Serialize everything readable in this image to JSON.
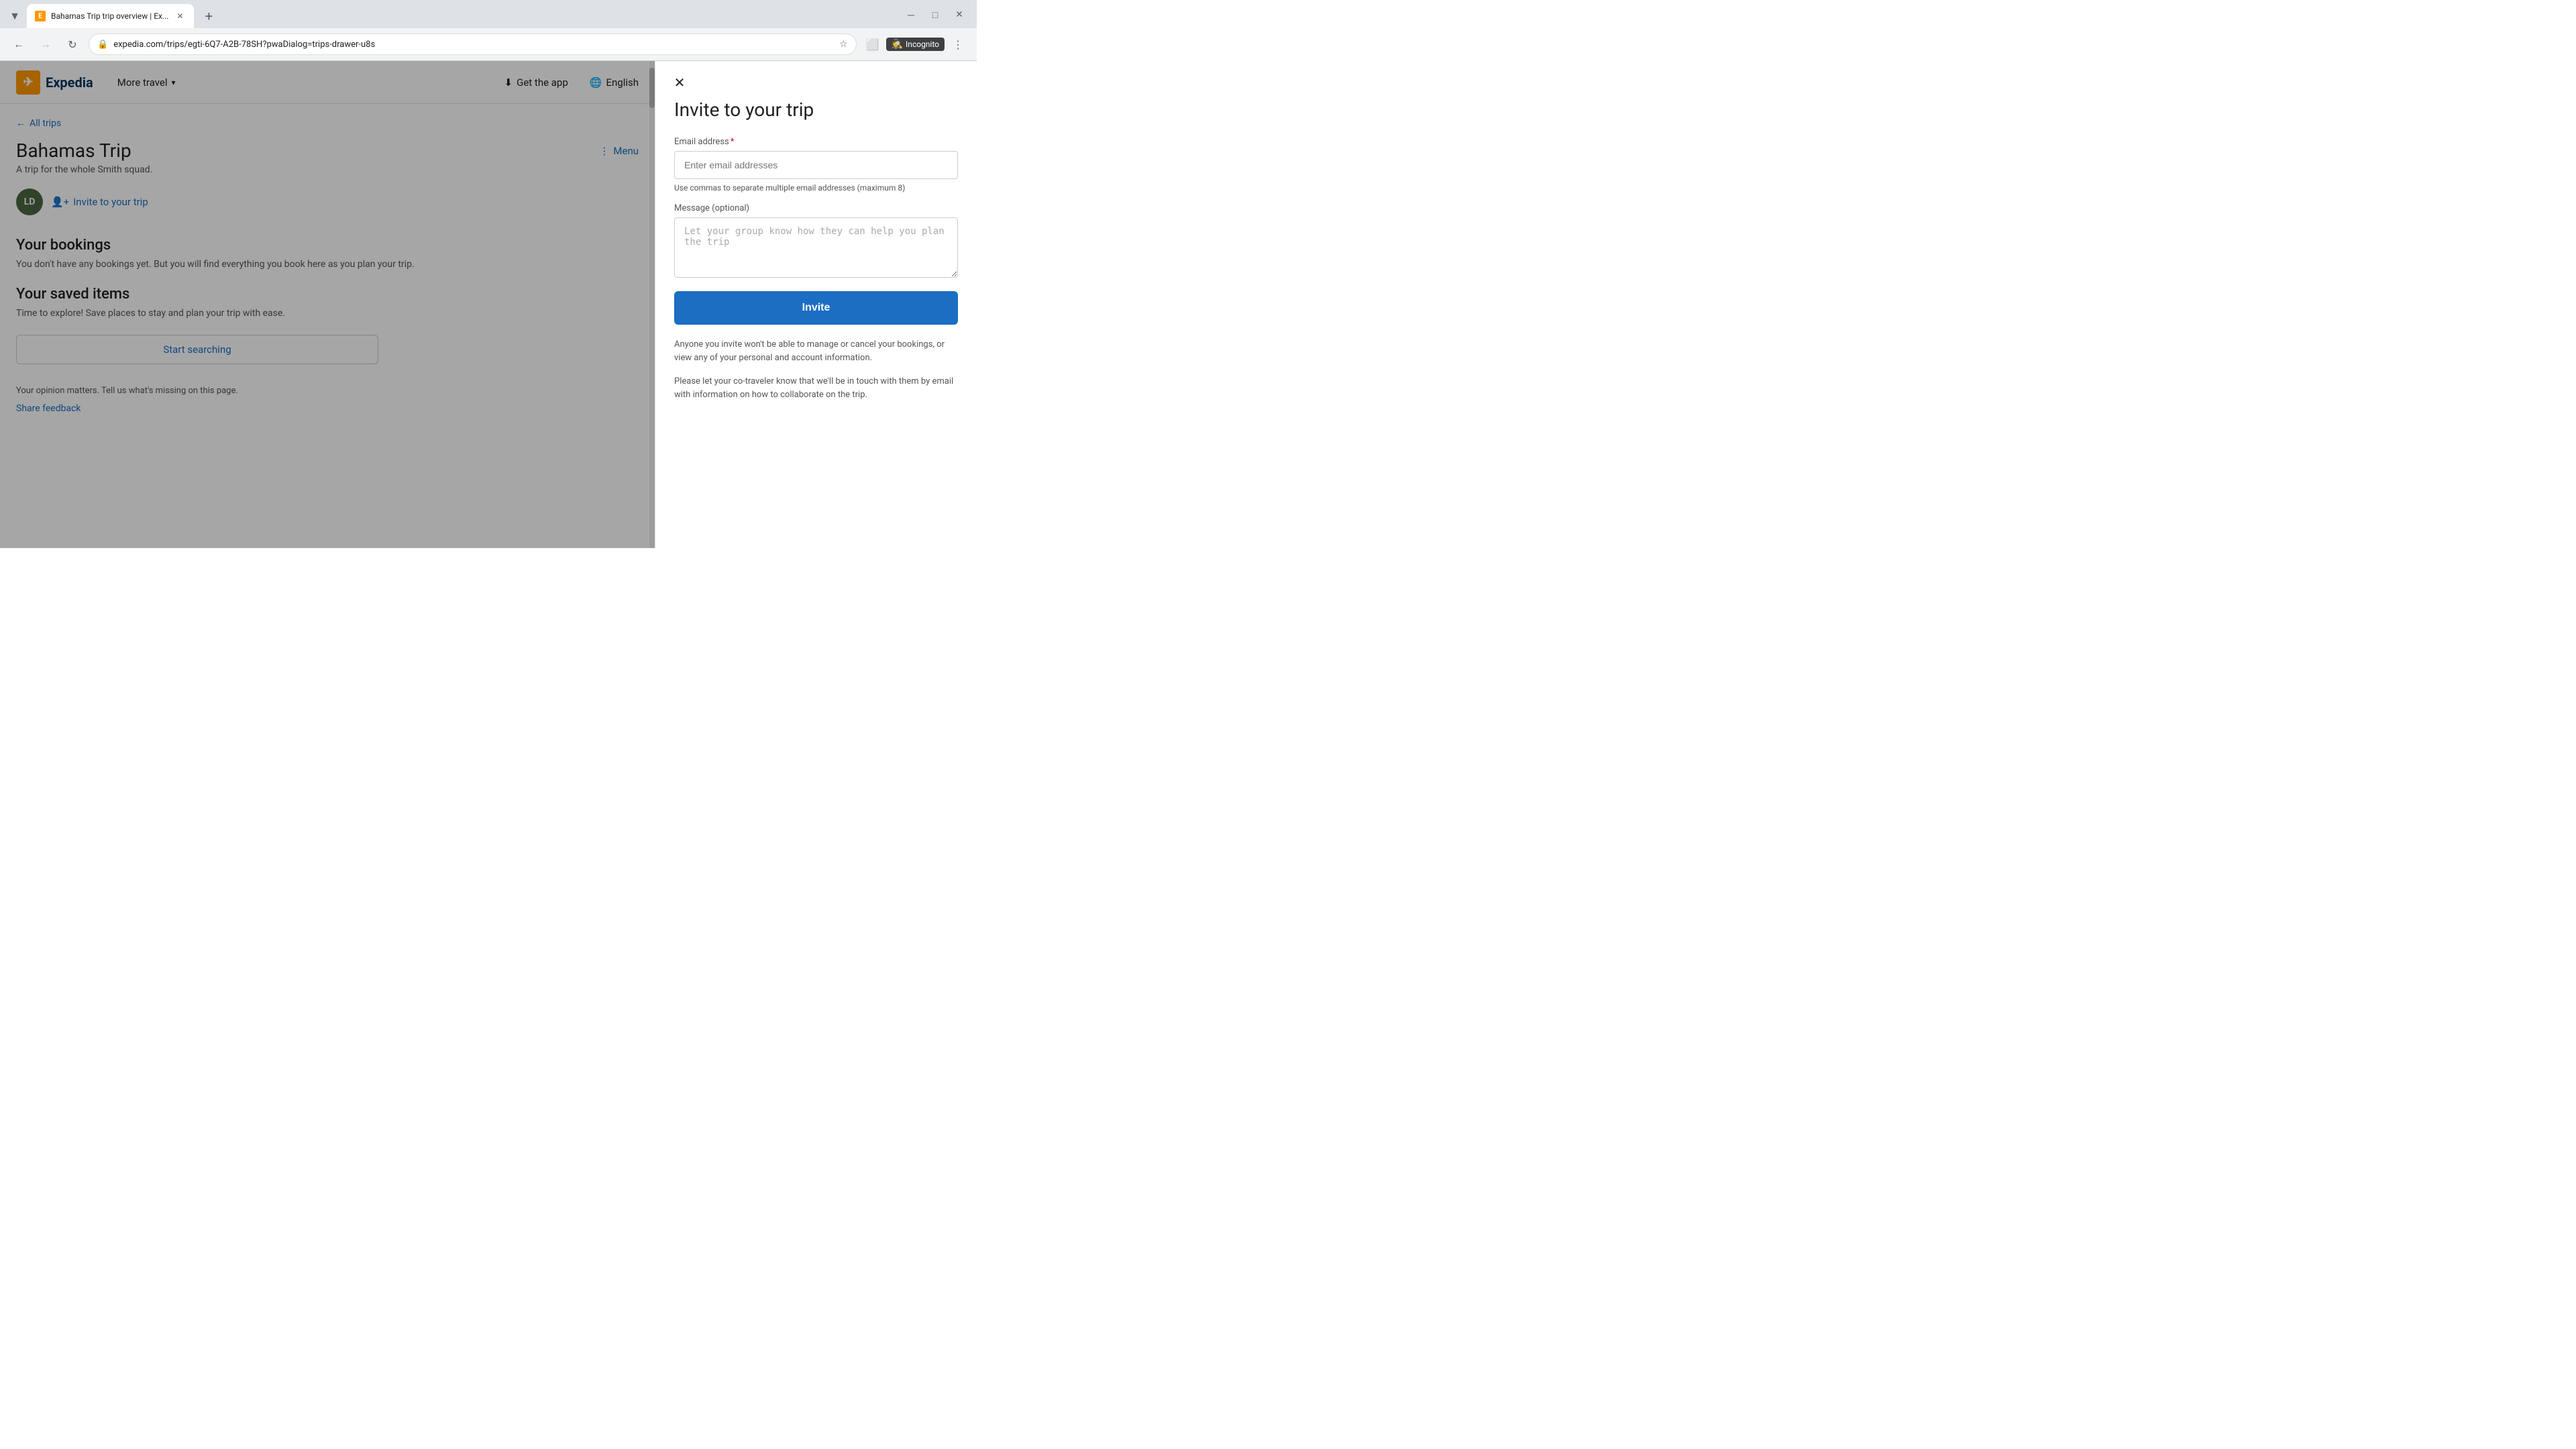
{
  "browser": {
    "tab_title": "Bahamas Trip trip overview | Ex...",
    "tab_favicon": "E",
    "url": "expedia.com/trips/egti-6Q7-A2B-78SH?pwaDialog=trips-drawer-u8s",
    "incognito_label": "Incognito"
  },
  "header": {
    "logo_text": "Expedia",
    "more_travel": "More travel",
    "get_app": "Get the app",
    "english": "English"
  },
  "trip": {
    "all_trips": "All trips",
    "title": "Bahamas Trip",
    "subtitle": "A trip for the whole Smith squad.",
    "avatar_initials": "LD",
    "invite_label": "Invite to your trip",
    "bookings_title": "Your bookings",
    "bookings_desc": "You don't have any bookings yet. But you will find everything you book here as you plan your trip.",
    "saved_title": "Your saved items",
    "saved_desc": "Time to explore! Save places to stay and plan your trip with ease.",
    "start_searching": "Start searching",
    "opinion_text": "Your opinion matters. Tell us what's missing on this page.",
    "share_feedback": "Share feedback",
    "menu_label": "Menu"
  },
  "drawer": {
    "title": "Invite to your trip",
    "email_label": "Email address",
    "email_required": "*",
    "email_placeholder": "Enter email addresses",
    "email_hint": "Use commas to separate multiple email addresses (maximum 8)",
    "message_label": "Message (optional)",
    "message_placeholder": "Let your group know how they can help you plan the trip",
    "invite_button": "Invite",
    "privacy_note": "Anyone you invite won't be able to manage or cancel your bookings, or view any of your personal and account information.",
    "collab_note": "Please let your co-traveler know that we'll be in touch with them by email with information on how to collaborate on the trip."
  }
}
